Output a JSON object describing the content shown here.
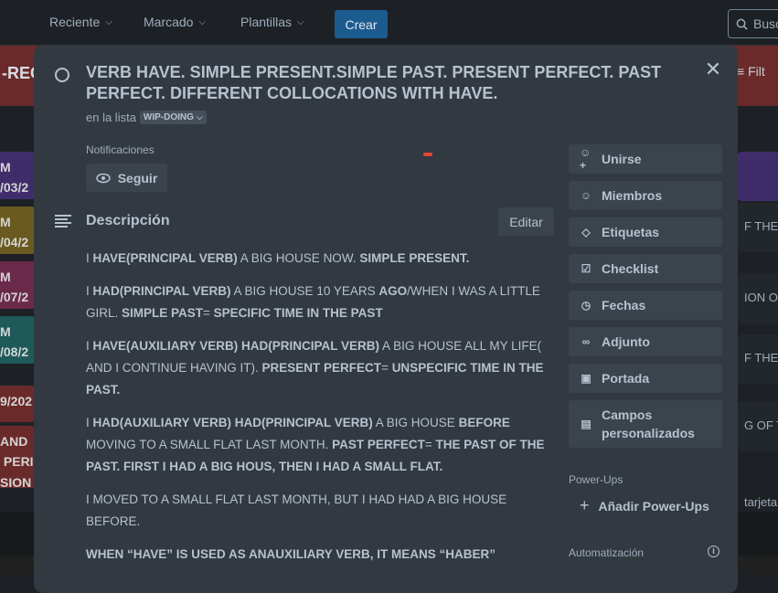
{
  "nav": {
    "items": [
      {
        "label": "Reciente"
      },
      {
        "label": "Marcado"
      },
      {
        "label": "Plantillas"
      }
    ],
    "create_label": "Crear",
    "search_placeholder": "Busc"
  },
  "board": {
    "title_fragment": "-REC",
    "filter_fragment": "Filt",
    "left_cards": [
      {
        "text": "M\n/03/2",
        "color": "#3f2d6b"
      },
      {
        "text": "M\n/04/2",
        "color": "#6b5a1f"
      },
      {
        "text": "M\n/07/2",
        "color": "#6b2a4a"
      },
      {
        "text": "M\n/08/2",
        "color": "#1f5a5a"
      },
      {
        "text": "9/202",
        "color": "#6b2a2a"
      },
      {
        "text": "AND\n PERI\nSION",
        "color": "#6b2a2a"
      }
    ],
    "right_cards": [
      {
        "text": ""
      },
      {
        "text": "F THE L"
      },
      {
        "text": "ION OF"
      },
      {
        "text": "F THE D"
      },
      {
        "text": "G OF T"
      },
      {
        "text": "tarjeta"
      }
    ]
  },
  "card": {
    "title": "VERB HAVE. SIMPLE PRESENT.SIMPLE PAST. PRESENT PERFECT. PAST PERFECT. DIFFERENT COLLOCATIONS WITH HAVE.",
    "in_list_label": "en la lista",
    "list_name": "WIP-DOING",
    "notifications_label": "Notificaciones",
    "follow_label": "Seguir",
    "description_title": "Descripción",
    "edit_label": "Editar",
    "description": [
      [
        {
          "t": "I "
        },
        {
          "t": "HAVE(PRINCIPAL VERB)",
          "b": true
        },
        {
          "t": " A BIG HOUSE NOW. "
        },
        {
          "t": "SIMPLE PRESENT.",
          "b": true
        }
      ],
      [
        {
          "t": "I "
        },
        {
          "t": "HAD(PRINCIPAL VERB)",
          "b": true
        },
        {
          "t": " A BIG HOUSE 10 YEARS "
        },
        {
          "t": "AGO",
          "b": true
        },
        {
          "t": "/WHEN I WAS A LITTLE GIRL. "
        },
        {
          "t": "SIMPLE PAST",
          "b": true
        },
        {
          "t": "= "
        },
        {
          "t": "SPECIFIC TIME IN THE PAST",
          "b": true
        }
      ],
      [
        {
          "t": "I "
        },
        {
          "t": "HAVE(AUXILIARY VERB) HAD(PRINCIPAL VERB)",
          "b": true
        },
        {
          "t": " A BIG HOUSE ALL MY LIFE( AND I CONTINUE HAVING IT). "
        },
        {
          "t": "PRESENT PERFECT",
          "b": true
        },
        {
          "t": "= "
        },
        {
          "t": "UNSPECIFIC TIME IN THE PAST.",
          "b": true
        }
      ],
      [
        {
          "t": "I "
        },
        {
          "t": "HAD(AUXILIARY VERB) HAD(PRINCIPAL VERB)",
          "b": true
        },
        {
          "t": " A BIG HOUSE "
        },
        {
          "t": "BEFORE",
          "b": true
        },
        {
          "t": " MOVING TO A SMALL FLAT LAST MONTH. "
        },
        {
          "t": "PAST PERFECT",
          "b": true
        },
        {
          "t": "= "
        },
        {
          "t": "THE PAST OF THE PAST. FIRST I HAD A BIG HOUS, THEN I HAD A SMALL FLAT.",
          "b": true
        }
      ],
      [
        {
          "t": "I MOVED TO A SMALL FLAT LAST MONTH, BUT I HAD HAD A BIG HOUSE BEFORE."
        }
      ],
      [
        {
          "t": "WHEN “HAVE” IS USED AS  ANAUXILIARY VERB, IT MEANS “HABER”",
          "b": true
        }
      ]
    ]
  },
  "sidebar": {
    "actions": [
      {
        "label": "Unirse",
        "icon": "add-user-icon"
      },
      {
        "label": "Miembros",
        "icon": "user-icon"
      },
      {
        "label": "Etiquetas",
        "icon": "tag-icon"
      },
      {
        "label": "Checklist",
        "icon": "checkbox-icon"
      },
      {
        "label": "Fechas",
        "icon": "clock-icon"
      },
      {
        "label": "Adjunto",
        "icon": "paperclip-icon"
      },
      {
        "label": "Portada",
        "icon": "cover-icon"
      },
      {
        "label": "Campos personalizados",
        "icon": "custom-fields-icon"
      }
    ],
    "powerups_label": "Power-Ups",
    "add_powerups_label": "Añadir Power-Ups",
    "automation_label": "Automatización"
  }
}
